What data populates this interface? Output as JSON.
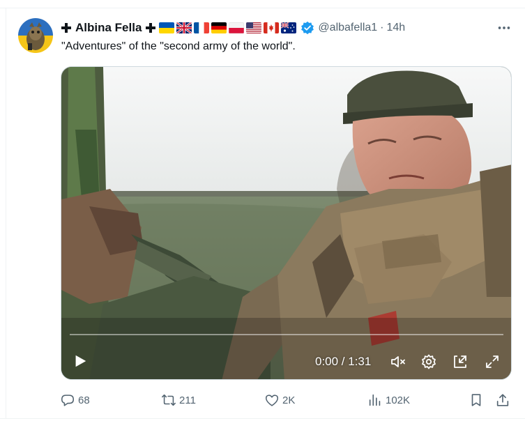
{
  "tweet": {
    "display_name": "Albina Fella",
    "handle": "@albafella1",
    "separator": "·",
    "time": "14h",
    "text": "\"Adventures\" of the \"second army of the world\".",
    "flags": [
      "ukraine-flag",
      "uk-flag",
      "france-flag",
      "germany-flag",
      "poland-flag",
      "usa-flag",
      "canada-flag",
      "australia-flag"
    ],
    "verified_color": "#1d9bf0"
  },
  "video": {
    "time_display": "0:00 / 1:31",
    "progress_fraction": 0,
    "controls": [
      "play-icon",
      "mute-icon",
      "settings-icon",
      "pip-icon",
      "fullscreen-icon"
    ]
  },
  "actions": {
    "replies": "68",
    "reposts": "211",
    "likes": "2K",
    "views": "102K"
  },
  "colors": {
    "text_primary": "#0f1419",
    "text_secondary": "#536471",
    "accent": "#1d9bf0"
  }
}
